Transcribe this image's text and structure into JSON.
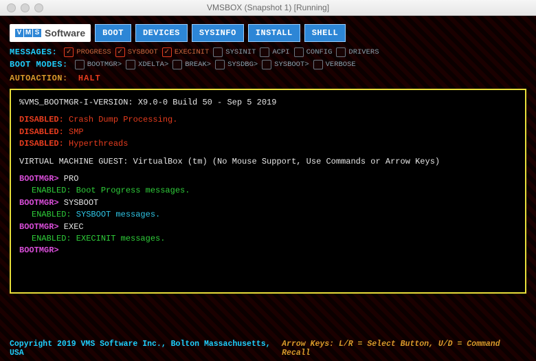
{
  "window": {
    "title": "VMSBOX (Snapshot 1) [Running]"
  },
  "logo": {
    "v": "V",
    "m": "M",
    "s": "S",
    "software": "Software"
  },
  "topButtons": [
    {
      "id": "boot",
      "label": "BOOT"
    },
    {
      "id": "devices",
      "label": "DEVICES"
    },
    {
      "id": "sysinfo",
      "label": "SYSINFO"
    },
    {
      "id": "install",
      "label": "INSTALL"
    },
    {
      "id": "shell",
      "label": "SHELL"
    }
  ],
  "messagesRow": {
    "label": "MESSAGES:",
    "items": [
      {
        "id": "progress",
        "label": "PROGRESS",
        "checked": true
      },
      {
        "id": "sysboot",
        "label": "SYSBOOT",
        "checked": true
      },
      {
        "id": "execinit",
        "label": "EXECINIT",
        "checked": true
      },
      {
        "id": "sysinit",
        "label": "SYSINIT",
        "checked": false
      },
      {
        "id": "acpi",
        "label": "ACPI",
        "checked": false
      },
      {
        "id": "config",
        "label": "CONFIG",
        "checked": false
      },
      {
        "id": "drivers",
        "label": "DRIVERS",
        "checked": false
      }
    ]
  },
  "bootModesRow": {
    "label": "BOOT MODES:",
    "items": [
      {
        "id": "bootmgr",
        "label": "BOOTMGR>",
        "checked": false
      },
      {
        "id": "xdelta",
        "label": "XDELTA>",
        "checked": false
      },
      {
        "id": "break",
        "label": "BREAK>",
        "checked": false
      },
      {
        "id": "sysdbg",
        "label": "SYSDBG>",
        "checked": false
      },
      {
        "id": "sysboot2",
        "label": "SYSBOOT>",
        "checked": false
      },
      {
        "id": "verbose",
        "label": "VERBOSE",
        "checked": false
      }
    ]
  },
  "autoaction": {
    "label": "AUTOACTION:",
    "value": "HALT"
  },
  "console": {
    "version": "%VMS_BOOTMGR-I-VERSION: X9.0-0 Build 50 - Sep  5 2019",
    "dis1a": "DISABLED:",
    "dis1b": " Crash Dump Processing.",
    "dis2a": "DISABLED:",
    "dis2b": " SMP",
    "dis3a": "DISABLED:",
    "dis3b": " Hyperthreads",
    "vm": "VIRTUAL MACHINE GUEST: VirtualBox (tm) (No Mouse Support, Use Commands or Arrow Keys)",
    "p1a": "BOOTMGR>",
    "p1b": " PRO",
    "e1a": "ENABLED:",
    "e1b": "  Boot Progress messages.",
    "p2a": "BOOTMGR>",
    "p2b": " SYSBOOT",
    "e2a": "ENABLED:",
    "e2b": "  SYSBOOT messages.",
    "p3a": "BOOTMGR>",
    "p3b": " EXEC",
    "e3a": "ENABLED:",
    "e3b": "  EXECINIT messages.",
    "p4a": "BOOTMGR>"
  },
  "footer": {
    "left": "Copyright 2019 VMS Software Inc., Bolton Massachusetts, USA",
    "right": "Arrow Keys: L/R = Select Button, U/D = Command Recall"
  }
}
